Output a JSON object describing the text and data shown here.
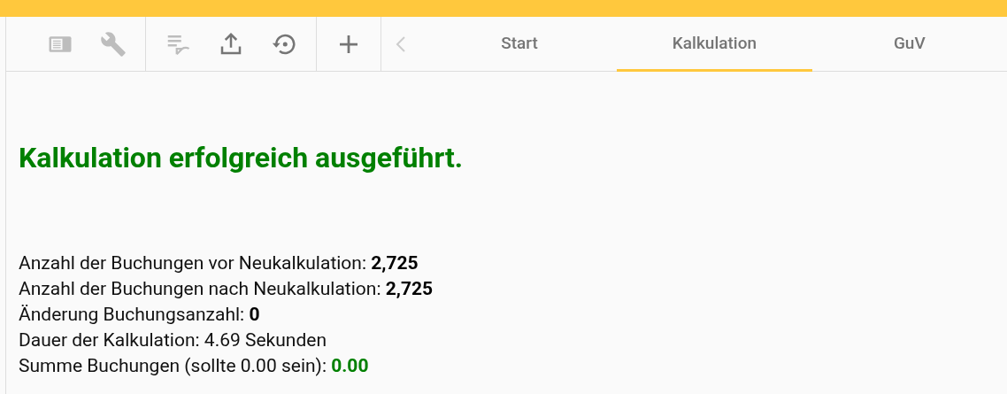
{
  "toolbar": {
    "groups": [
      [
        {
          "kind": "sidebar",
          "disabled": true
        },
        {
          "kind": "wrench",
          "disabled": true
        }
      ],
      [
        {
          "kind": "sort",
          "disabled": true
        },
        {
          "kind": "upload",
          "disabled": false
        },
        {
          "kind": "restore",
          "disabled": false
        }
      ],
      [
        {
          "kind": "plus",
          "disabled": false
        }
      ]
    ],
    "back": {
      "disabled": true
    }
  },
  "tabs": [
    {
      "label": "Start",
      "selected": false
    },
    {
      "label": "Kalkulation",
      "selected": true
    },
    {
      "label": "GuV",
      "selected": false
    }
  ],
  "message": "Kalkulation erfolgreich ausgeführt.",
  "stats": [
    {
      "label": "Anzahl der Buchungen vor Neukalkulation:",
      "value": "2,725",
      "kind": "bold"
    },
    {
      "label": "Anzahl der Buchungen nach Neukalkulation:",
      "value": "2,725",
      "kind": "bold"
    },
    {
      "label": "Änderung Buchungsanzahl:",
      "value": "0",
      "kind": "bold"
    },
    {
      "label": "Dauer der Kalkulation:",
      "value": "4.69 Sekunden",
      "kind": "plain"
    },
    {
      "label": "Summe Buchungen (sollte 0.00 sein):",
      "value": "0.00",
      "kind": "success"
    }
  ]
}
